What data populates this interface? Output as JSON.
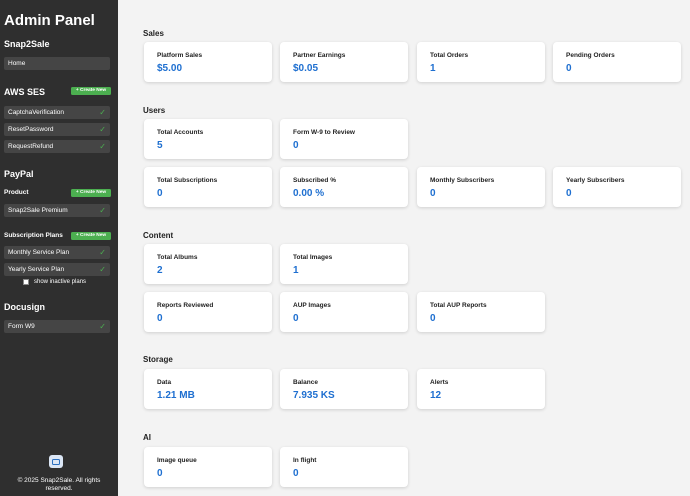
{
  "sidebar": {
    "title": "Admin Panel",
    "snap2sale": {
      "heading": "Snap2Sale",
      "items": [
        {
          "label": "Home"
        }
      ]
    },
    "aws_ses": {
      "heading": "AWS SES",
      "create_label": "+ Create New",
      "items": [
        {
          "label": "CaptchaVerification",
          "check": "✓"
        },
        {
          "label": "ResetPassword",
          "check": "✓"
        },
        {
          "label": "RequestRefund",
          "check": "✓"
        }
      ]
    },
    "paypal": {
      "heading": "PayPal",
      "product": {
        "heading": "Product",
        "create_label": "+ Create New",
        "items": [
          {
            "label": "Snap2Sale Premium",
            "check": "✓"
          }
        ]
      },
      "plans": {
        "heading": "Subscription Plans",
        "create_label": "+ Create New",
        "items": [
          {
            "label": "Monthly Service Plan",
            "check": "✓"
          },
          {
            "label": "Yearly Service Plan",
            "check": "✓"
          }
        ],
        "show_inactive_label": "show inactive plans"
      }
    },
    "docusign": {
      "heading": "Docusign",
      "items": [
        {
          "label": "Form W9",
          "check": "✓"
        }
      ]
    },
    "footer": {
      "copyright": "© 2025 Snap2Sale. All rights reserved."
    }
  },
  "main": {
    "sales": {
      "title": "Sales",
      "cards": [
        {
          "label": "Platform Sales",
          "value": "$5.00"
        },
        {
          "label": "Partner Earnings",
          "value": "$0.05"
        },
        {
          "label": "Total Orders",
          "value": "1"
        },
        {
          "label": "Pending Orders",
          "value": "0"
        }
      ]
    },
    "users": {
      "title": "Users",
      "cards": [
        {
          "label": "Total Accounts",
          "value": "5"
        },
        {
          "label": "Form W-9 to Review",
          "value": "0"
        },
        {
          "label": "Total Subscriptions",
          "value": "0"
        },
        {
          "label": "Subscribed %",
          "value": "0.00 %"
        },
        {
          "label": "Monthly Subscribers",
          "value": "0"
        },
        {
          "label": "Yearly Subscribers",
          "value": "0"
        }
      ]
    },
    "content": {
      "title": "Content",
      "cards": [
        {
          "label": "Total Albums",
          "value": "2"
        },
        {
          "label": "Total Images",
          "value": "1"
        },
        {
          "label": "Reports Reviewed",
          "value": "0"
        },
        {
          "label": "AUP Images",
          "value": "0"
        },
        {
          "label": "Total AUP Reports",
          "value": "0"
        }
      ]
    },
    "storage": {
      "title": "Storage",
      "cards": [
        {
          "label": "Data",
          "value": "1.21 MB"
        },
        {
          "label": "Balance",
          "value": "7.935 KS"
        },
        {
          "label": "Alerts",
          "value": "12"
        }
      ]
    },
    "ai": {
      "title": "AI",
      "cards": [
        {
          "label": "Image queue",
          "value": "0"
        },
        {
          "label": "In flight",
          "value": "0"
        }
      ]
    }
  }
}
